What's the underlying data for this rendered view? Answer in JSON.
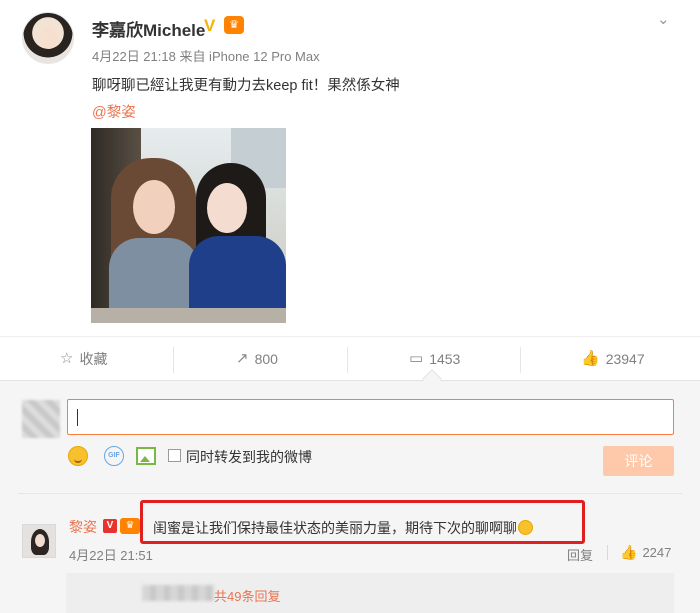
{
  "post": {
    "author": "李嘉欣Michele",
    "verified_badge": "V",
    "vip_icon": "crown-icon",
    "meta": "4月22日 21:18 来自 iPhone 12 Pro Max",
    "text": "聊呀聊已經让我更有動力去keep fit！果然係女神",
    "mention": "@黎姿",
    "menu_icon": "chevron-down-icon"
  },
  "actions": {
    "favorite_label": "收藏",
    "repost_count": "800",
    "comment_count": "1453",
    "like_count": "23947"
  },
  "comment_box": {
    "value": "",
    "repost_label": "同时转发到我的微博",
    "gif_label": "GIF",
    "submit_label": "评论"
  },
  "comment": {
    "author": "黎姿",
    "badge": "V",
    "text": "闺蜜是让我们保持最佳状态的美丽力量，期待下次的聊啊聊",
    "time": "4月22日 21:51",
    "reply_label": "回复",
    "like_count": "2247",
    "more_replies": "共49条回复"
  },
  "colors": {
    "accent": "#eb7350",
    "input_border": "#fa7d3c",
    "submit_bg": "#fec9ab",
    "highlight": "#e02020"
  }
}
